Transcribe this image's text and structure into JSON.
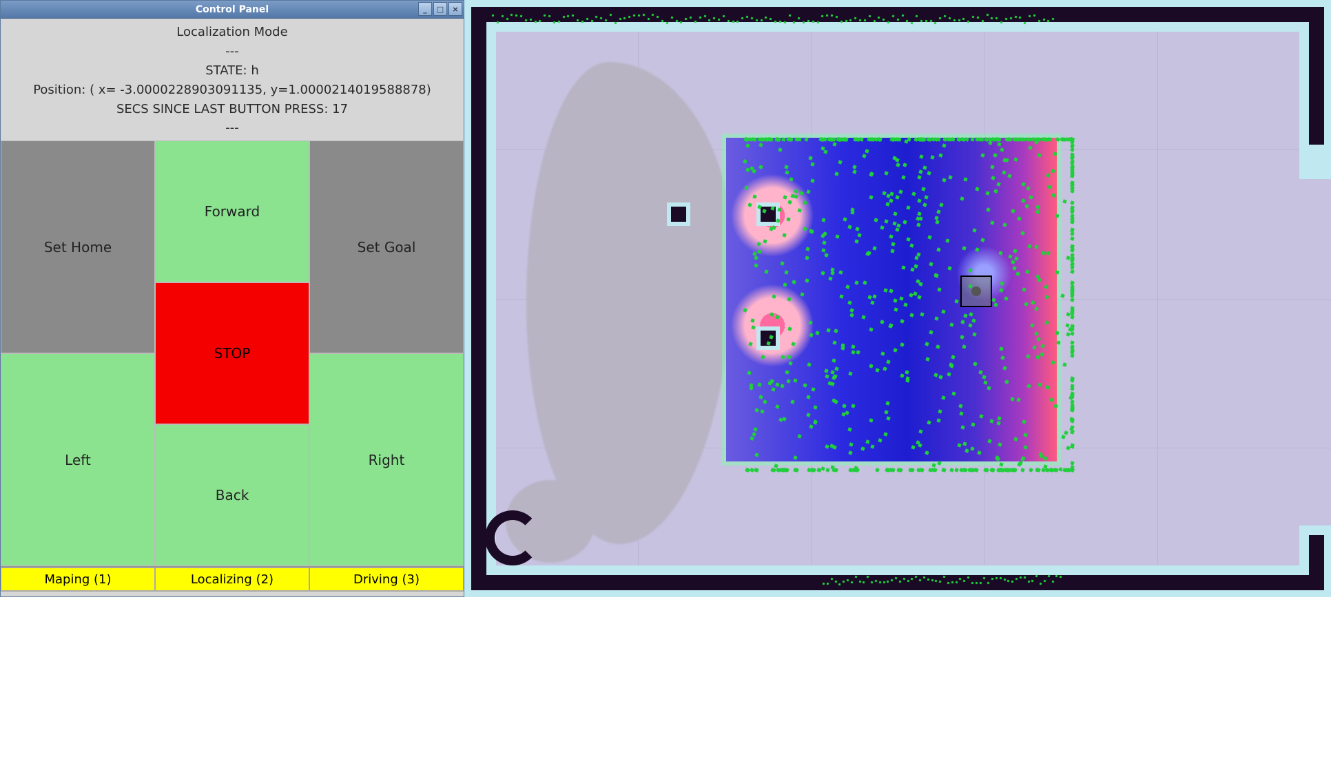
{
  "window": {
    "title": "Control Panel",
    "controls": {
      "min": "_",
      "max": "□",
      "close": "×"
    }
  },
  "status": {
    "mode": "Localization Mode",
    "sep1": "---",
    "state": "STATE: h",
    "position": "Position: ( x= -3.0000228903091135, y=1.0000214019588878)",
    "secs": "SECS SINCE LAST BUTTON PRESS: 17",
    "sep2": "---"
  },
  "buttons": {
    "set_home": "Set Home",
    "set_goal": "Set Goal",
    "forward": "Forward",
    "stop": "STOP",
    "left": "Left",
    "back": "Back",
    "right": "Right"
  },
  "modes": {
    "mapping": "Maping (1)",
    "localizing": "Localizing (2)",
    "driving": "Driving (3)"
  },
  "colors": {
    "button_gray": "#8a8a8a",
    "button_green": "#8be28f",
    "button_red": "#f40000",
    "mode_yellow": "#ffff00",
    "particle_green": "#1fd03a"
  },
  "map": {
    "description": "costmap-visualization",
    "robot_marker": "robot-pose"
  }
}
